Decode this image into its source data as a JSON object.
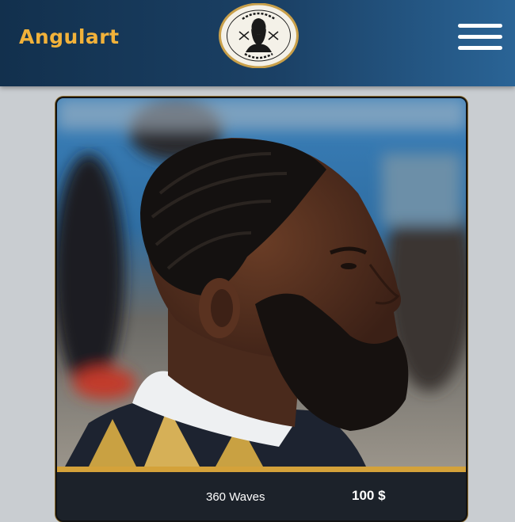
{
  "header": {
    "brand": "Angulart",
    "logo_icon": "barber-shop-logo-icon",
    "menu_icon": "hamburger-menu-icon"
  },
  "card": {
    "image": "barber-client-portrait",
    "service_name": "360 Waves",
    "price": "100 $"
  },
  "colors": {
    "brand_text": "#f2b23a",
    "header_bg": "#1b4166",
    "accent_gold": "#d4a23a",
    "card_footer": "#1c222a",
    "page_bg": "#c9cdd1"
  }
}
